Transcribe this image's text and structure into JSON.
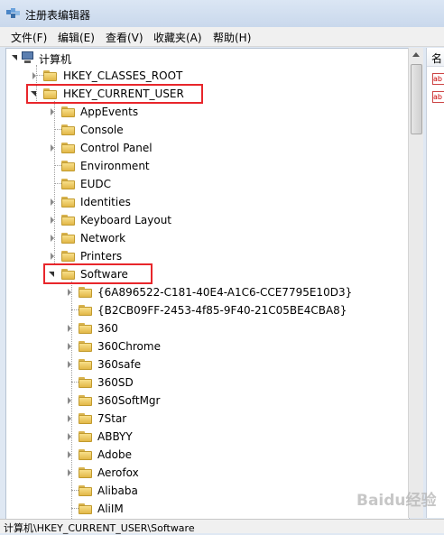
{
  "window": {
    "title": "注册表编辑器"
  },
  "menu": [
    "文件(F)",
    "编辑(E)",
    "查看(V)",
    "收藏夹(A)",
    "帮助(H)"
  ],
  "tree": {
    "root": "计算机",
    "hives": {
      "classes_root": "HKEY_CLASSES_ROOT",
      "current_user": "HKEY_CURRENT_USER"
    },
    "current_user_children": [
      "AppEvents",
      "Console",
      "Control Panel",
      "Environment",
      "EUDC",
      "Identities",
      "Keyboard Layout",
      "Network",
      "Printers",
      "Software"
    ],
    "software_children": [
      "{6A896522-C181-40E4-A1C6-CCE7795E10D3}",
      "{B2CB09FF-2453-4f85-9F40-21C05BE4CBA8}",
      "360",
      "360Chrome",
      "360safe",
      "360SD",
      "360SoftMgr",
      "7Star",
      "ABBYY",
      "Adobe",
      "Aerofox",
      "Alibaba",
      "AliIM"
    ]
  },
  "right_pane": {
    "column_header": "名"
  },
  "status_bar": {
    "path": "计算机\\HKEY_CURRENT_USER\\Software"
  },
  "watermark": "Baidu经验",
  "colors": {
    "highlight": "#e8262b",
    "folder": "#f2cf6a"
  }
}
